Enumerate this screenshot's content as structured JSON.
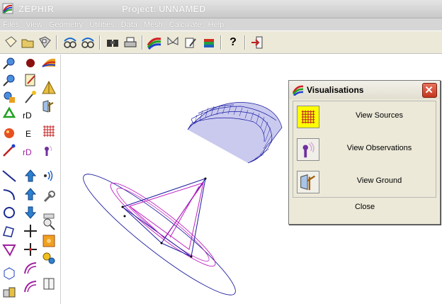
{
  "app": {
    "name": "ZEPHIR",
    "project_title": "Project: UNNAMED"
  },
  "menu": [
    "Files",
    "View",
    "Geometry",
    "Utilities",
    "Data",
    "Mesh",
    "Calculate",
    "Help"
  ],
  "toolbar": {
    "help_label": "?"
  },
  "palette": {
    "label_rd1": "rD",
    "label_e": "E",
    "label_rd2": "rD"
  },
  "dialog": {
    "title": "Visualisations",
    "rows": [
      {
        "label": "View Sources",
        "icon": "sources-grid-icon",
        "highlighted": true
      },
      {
        "label": "View Observations",
        "icon": "observation-antenna-icon",
        "highlighted": false
      },
      {
        "label": "View Ground",
        "icon": "ground-icon",
        "highlighted": false
      }
    ],
    "close_label": "Close"
  },
  "colors": {
    "wireframe_blue": "#1a1aa0",
    "wireframe_magenta": "#c020c0",
    "highlight_yellow": "#ffff00"
  }
}
